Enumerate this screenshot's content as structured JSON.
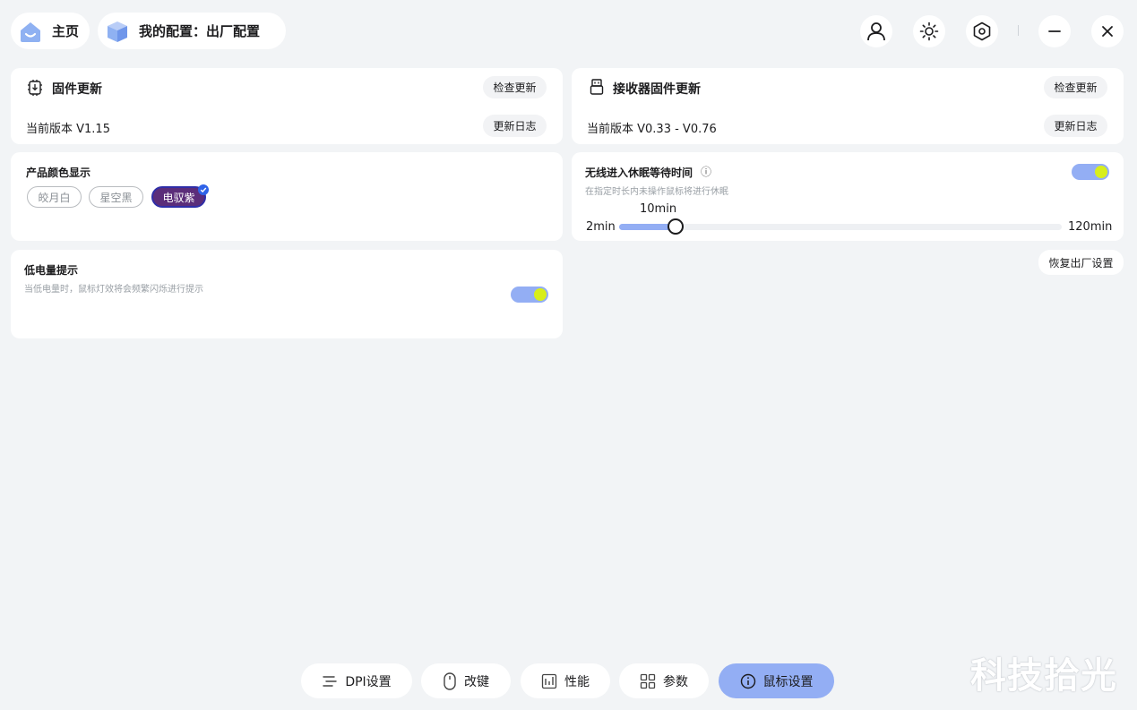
{
  "header": {
    "home_label": "主页",
    "config_label": "我的配置：出厂配置",
    "icons": [
      "home-icon",
      "cube-icon",
      "user-icon",
      "brightness-icon",
      "settings-hex-icon",
      "minimize-icon",
      "close-icon"
    ]
  },
  "firmware": {
    "title": "固件更新",
    "check_label": "检查更新",
    "version": "当前版本 V1.15",
    "log_label": "更新日志"
  },
  "receiver": {
    "title": "接收器固件更新",
    "check_label": "检查更新",
    "version": "当前版本 V0.33 - V0.76",
    "log_label": "更新日志"
  },
  "color_display": {
    "title": "产品颜色显示",
    "options": [
      "皎月白",
      "星空黑",
      "电驭紫"
    ],
    "selected": "电驭紫",
    "selected_bg": "#5b2d7a"
  },
  "sleep": {
    "title": "无线进入休眠等待时间",
    "info_icon": "ⓘ",
    "hint": "在指定时长内未操作鼠标将进行休眠",
    "enabled": true,
    "min_label": "2min",
    "max_label": "120min",
    "min": 2,
    "max": 120,
    "value": 10,
    "value_label": "10min"
  },
  "low_battery": {
    "title": "低电量提示",
    "hint": "当低电量时，鼠标灯效将会频繁闪烁进行提示",
    "enabled": true
  },
  "restore_label": "恢复出厂设置",
  "bottom_tabs": [
    {
      "label": "DPI设置",
      "icon": "dpi-icon"
    },
    {
      "label": "改键",
      "icon": "mouse-icon"
    },
    {
      "label": "性能",
      "icon": "performance-icon"
    },
    {
      "label": "参数",
      "icon": "grid-icon"
    },
    {
      "label": "鼠标设置",
      "icon": "info-icon",
      "active": true
    }
  ],
  "watermark": "科技拾光",
  "colors": {
    "accent": "#93aef4",
    "toggle_knob": "#d8ee1b",
    "background": "#f2f4f6"
  }
}
